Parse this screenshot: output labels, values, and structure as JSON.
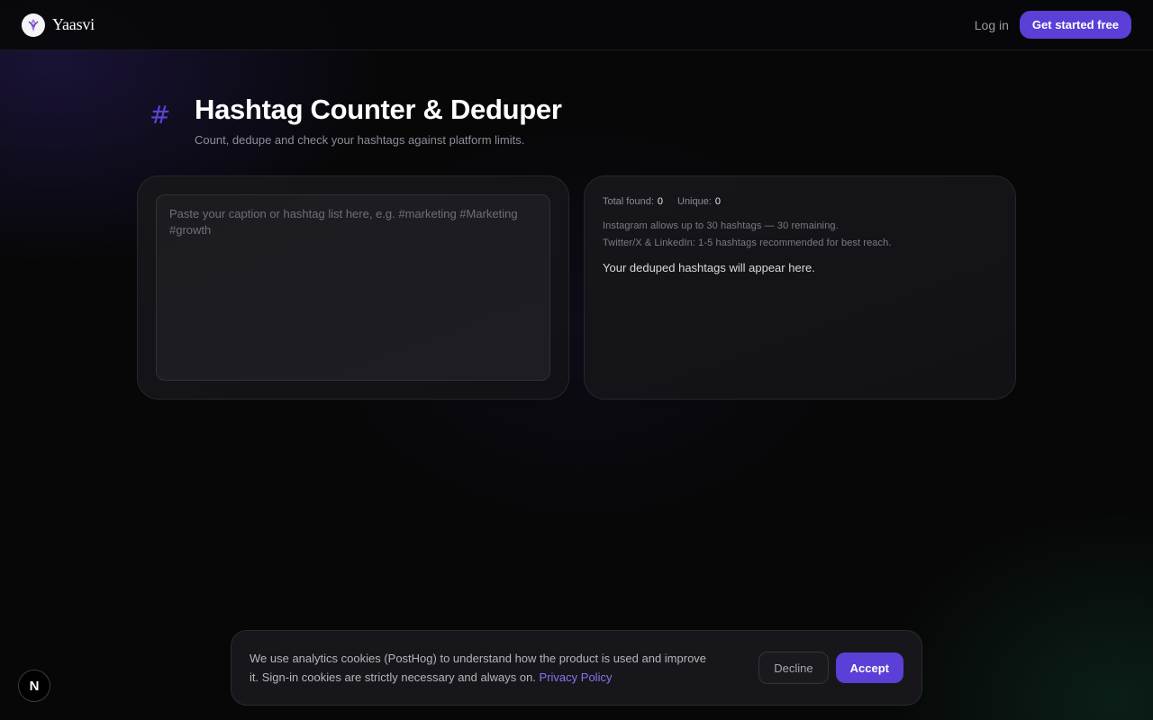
{
  "header": {
    "brand_name": "Yaasvi",
    "login_label": "Log in",
    "cta_label": "Get started free"
  },
  "page": {
    "icon_glyph": "#",
    "title": "Hashtag Counter & Deduper",
    "subtitle": "Count, dedupe and check your hashtags against platform limits."
  },
  "input_panel": {
    "value": "",
    "placeholder": "Paste your caption or hashtag list here, e.g. #marketing #Marketing #growth"
  },
  "results_panel": {
    "total_label": "Total found:",
    "total_value": "0",
    "unique_label": "Unique:",
    "unique_value": "0",
    "instagram_note": "Instagram allows up to 30 hashtags — 30 remaining.",
    "twitter_note": "Twitter/X & LinkedIn: 1-5 hashtags recommended for best reach.",
    "empty_message": "Your deduped hashtags will appear here."
  },
  "cookie_banner": {
    "text": "We use analytics cookies (PostHog) to understand how the product is used and improve it. Sign-in cookies are strictly necessary and always on.",
    "privacy_link": "Privacy Policy",
    "decline_label": "Decline",
    "accept_label": "Accept"
  },
  "dev_badge": {
    "label": "N"
  },
  "colors": {
    "accent": "#5b3fd6",
    "link": "#8b73f0",
    "background": "#070708"
  },
  "icons": {
    "logo": "yaasvi-logo-icon",
    "heading": "hashtag-icon",
    "dev_badge": "nextjs-icon"
  }
}
